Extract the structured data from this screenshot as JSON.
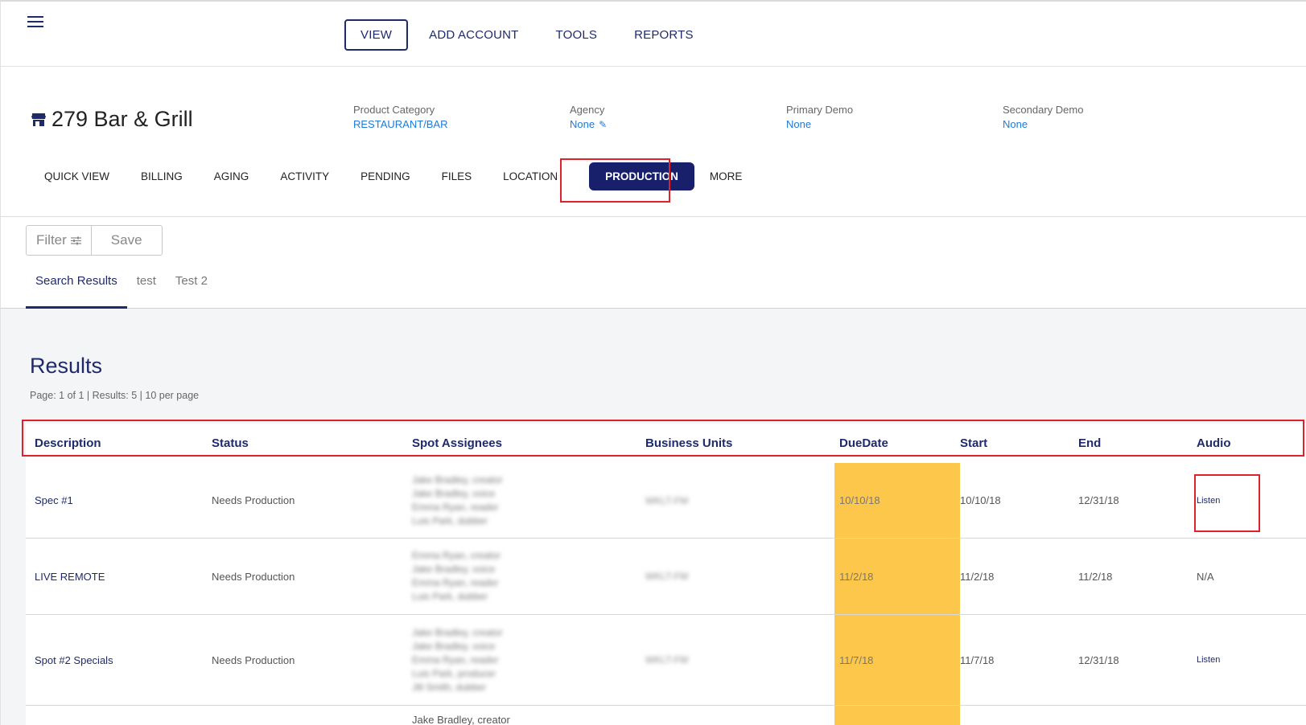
{
  "topnav": {
    "items": [
      {
        "label": "VIEW",
        "active": true
      },
      {
        "label": "ADD ACCOUNT"
      },
      {
        "label": "TOOLS"
      },
      {
        "label": "REPORTS"
      }
    ]
  },
  "account": {
    "name": "279 Bar & Grill",
    "meta": [
      {
        "label": "Product Category",
        "value": "RESTAURANT/BAR"
      },
      {
        "label": "Agency",
        "value": "None"
      },
      {
        "label": "Primary Demo",
        "value": "None"
      },
      {
        "label": "Secondary Demo",
        "value": "None"
      }
    ]
  },
  "subnav": {
    "items": [
      "QUICK VIEW",
      "BILLING",
      "AGING",
      "ACTIVITY",
      "PENDING",
      "FILES",
      "LOCATION",
      "PRODUCTION",
      "MORE"
    ],
    "active": "PRODUCTION"
  },
  "filter": {
    "filter_label": "Filter",
    "save_label": "Save"
  },
  "tabs": [
    "Search Results",
    "test",
    "Test 2"
  ],
  "results": {
    "title": "Results",
    "page_info": "Page: 1 of 1  |  Results: 5  |  10 per page",
    "columns": [
      "Description",
      "Status",
      "Spot Assignees",
      "Business Units",
      "DueDate",
      "Start",
      "End",
      "Audio"
    ],
    "rows": [
      {
        "description": "Spec #1",
        "status": "Needs Production",
        "assignees": [
          "Jake Bradley, creator",
          "Jake Bradley, voice",
          "Emma Ryan, reader",
          "Luis Park, dubber"
        ],
        "business_unit": "WKLT-FM",
        "due": "10/10/18",
        "start": "10/10/18",
        "end": "12/31/18",
        "audio": "Listen"
      },
      {
        "description": "LIVE REMOTE",
        "status": "Needs Production",
        "assignees": [
          "Emma Ryan, creator",
          "Jake Bradley, voice",
          "Emma Ryan, reader",
          "Luis Park, dubber"
        ],
        "business_unit": "WKLT-FM",
        "due": "11/2/18",
        "start": "11/2/18",
        "end": "11/2/18",
        "audio": "N/A"
      },
      {
        "description": "Spot #2 Specials",
        "status": "Needs Production",
        "assignees": [
          "Jake Bradley, creator",
          "Jake Bradley, voice",
          "Emma Ryan, reader",
          "Luis Park, producer",
          "Jill Smith, dubber"
        ],
        "business_unit": "WKLT-FM",
        "due": "11/7/18",
        "start": "11/7/18",
        "end": "12/31/18",
        "audio": "Listen"
      }
    ],
    "partial_row_assignee": "Jake Bradley, creator"
  },
  "colors": {
    "brand": "#1f2a6b",
    "link": "#1e7ad8",
    "due_highlight": "#fcc74b",
    "annotation": "#e0202a"
  }
}
